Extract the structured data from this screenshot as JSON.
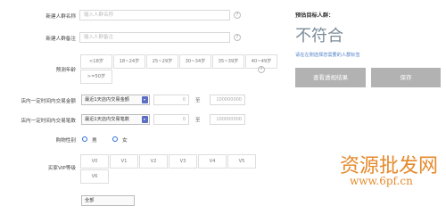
{
  "form": {
    "name_label": "新建人群名称",
    "name_placeholder": "输入人群名称",
    "note_label": "新建人群备注",
    "note_placeholder": "输入人群备注",
    "age_label": "预测年龄",
    "age_options": [
      "<18岁",
      "18~24岁",
      "25~29岁",
      "30~34岁",
      "35~39岁",
      "40~49岁",
      ">=50岁"
    ],
    "amount_label": "店内一定时间内交易金额",
    "amount_select": "最近1天店内交易金额",
    "amount_min": "0",
    "amount_to": "至",
    "amount_max": "100000000",
    "count_label": "店内一定时间内交易笔数",
    "count_select": "最近1天店内交易笔数",
    "count_min": "0",
    "count_to": "至",
    "count_max": "100000000",
    "gender_label": "购物性别",
    "gender_male": "男",
    "gender_female": "女",
    "vip_label": "买家VIP等级",
    "vip_options": [
      "V0",
      "V1",
      "V2",
      "V3",
      "V4",
      "V5",
      "V6"
    ],
    "bottom_select": "全部"
  },
  "estimate": {
    "title": "预估目标人群：",
    "result": "不符合",
    "hint": "请在左侧选择您需要的人群标签"
  },
  "buttons": {
    "view": "查看透视结果",
    "save": "保存"
  },
  "watermark": {
    "cn": "资源批发网",
    "url": "www.6pf.cn"
  }
}
